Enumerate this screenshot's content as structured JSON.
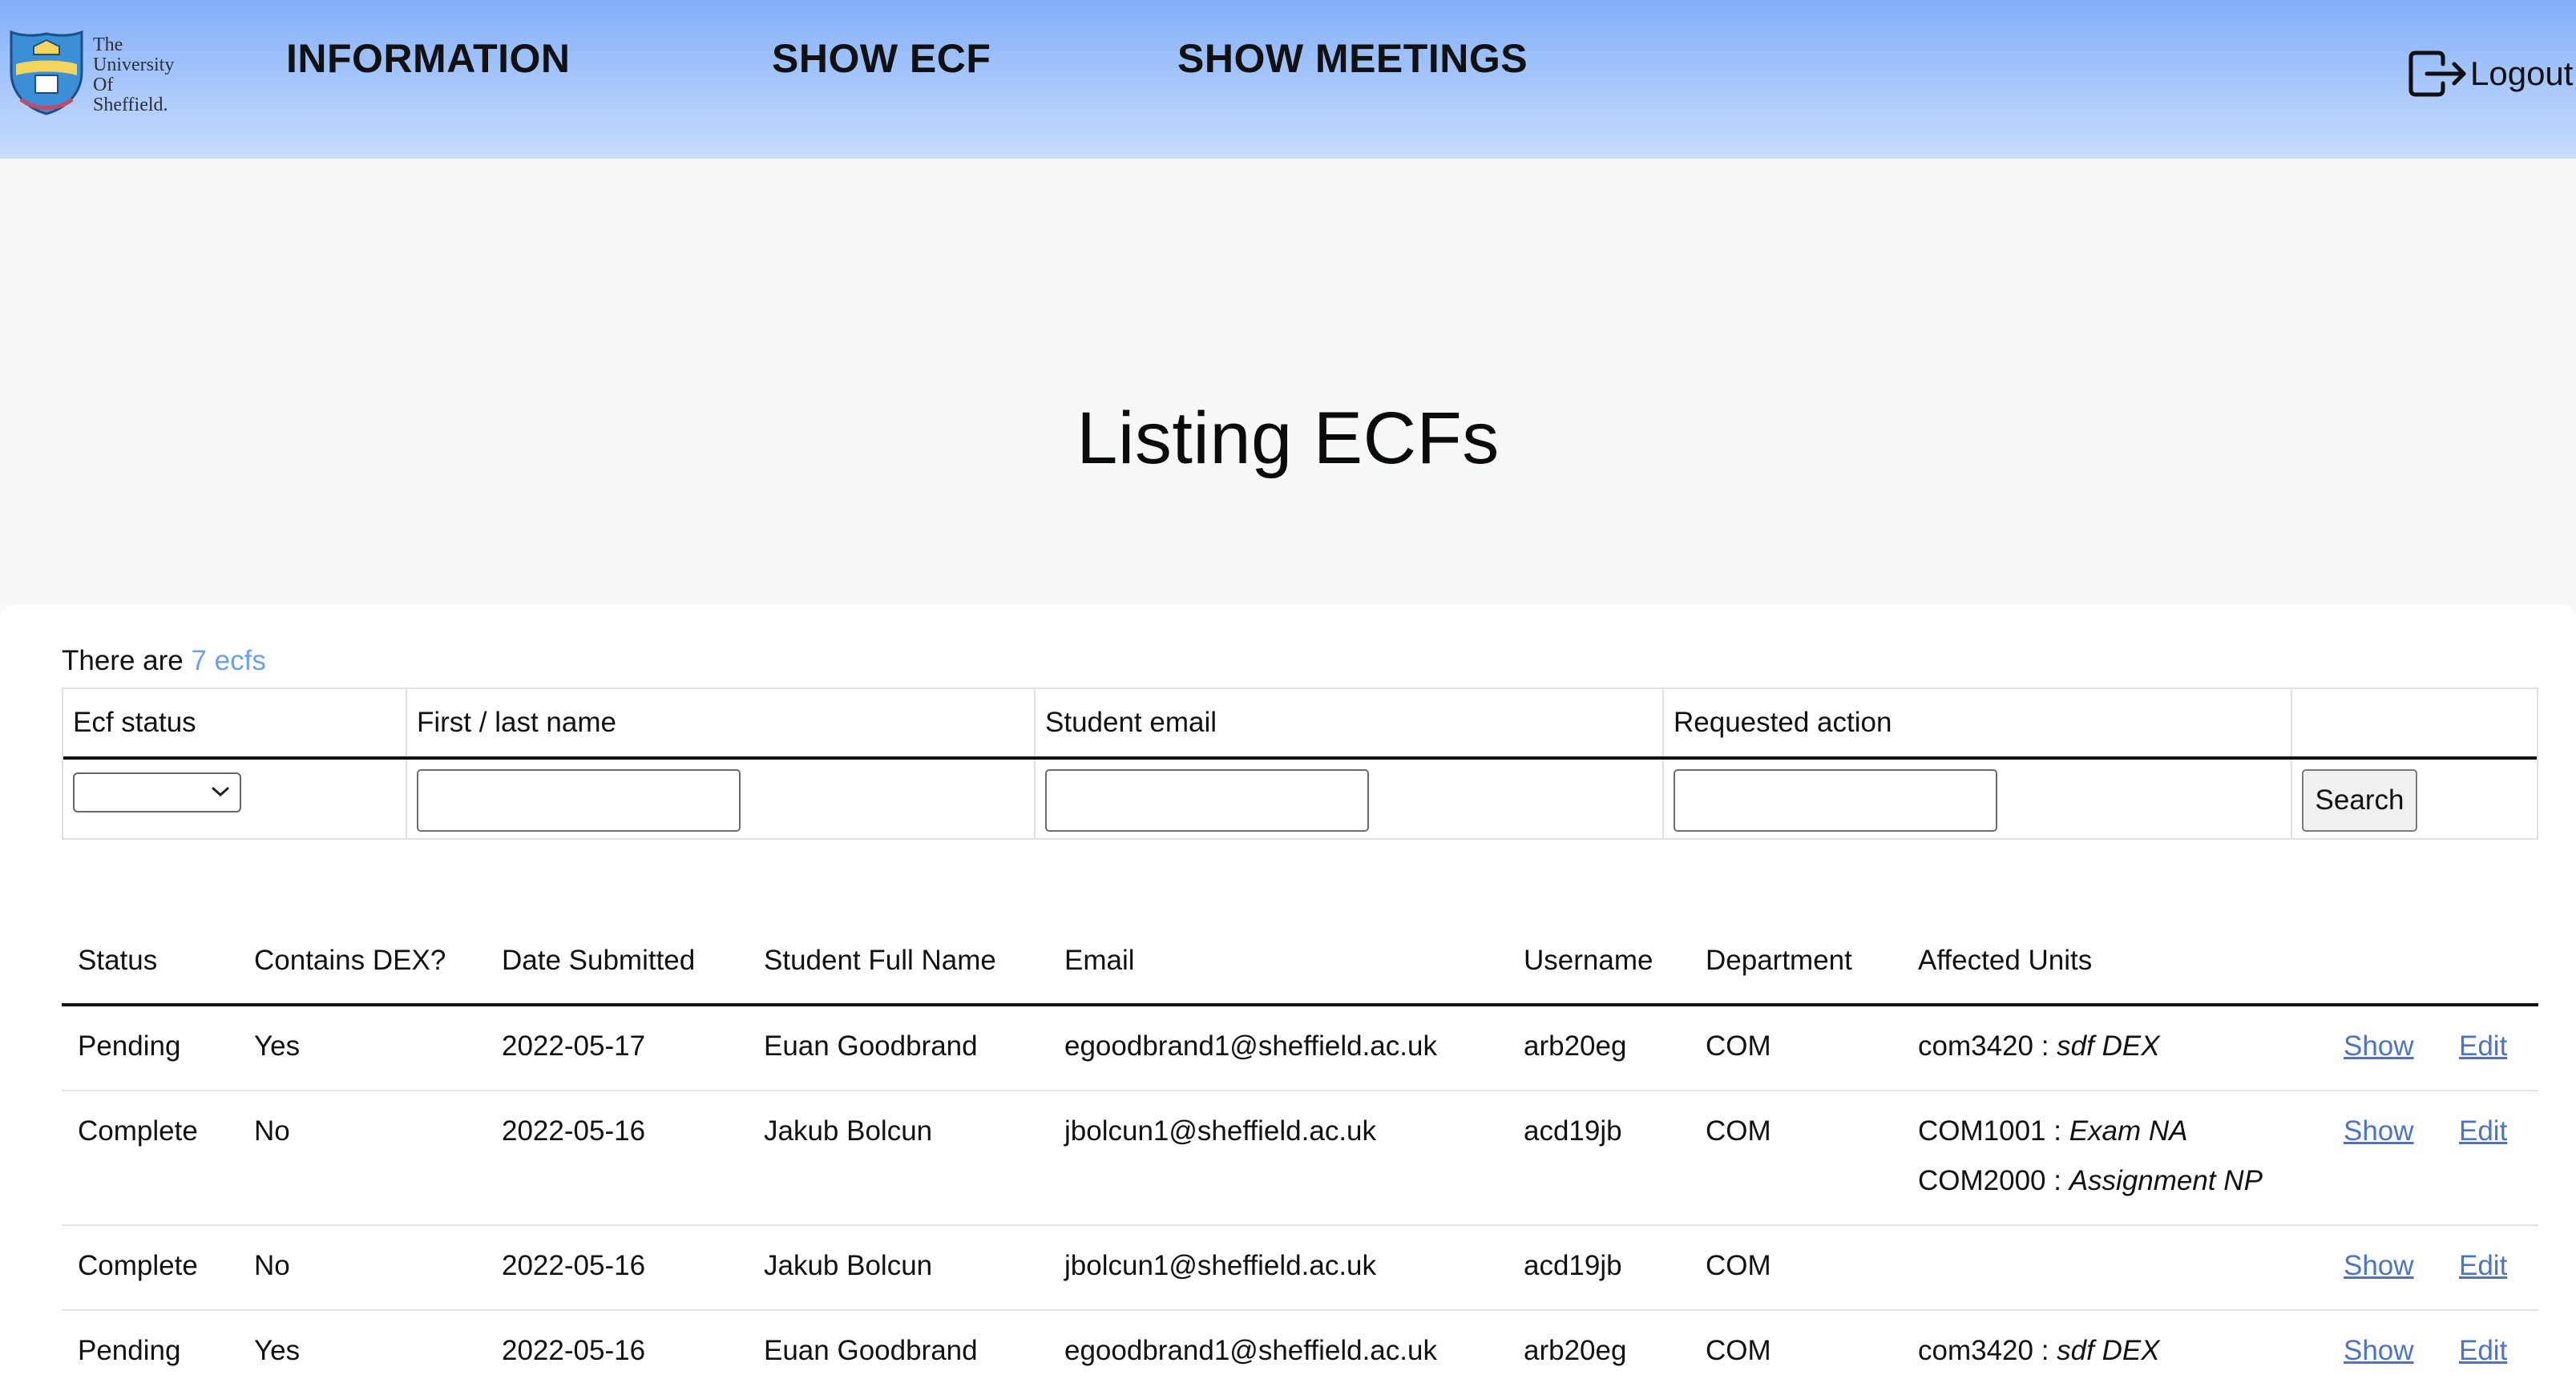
{
  "nav": {
    "logo_lines": [
      "The",
      "University",
      "Of",
      "Sheffield."
    ],
    "items": [
      {
        "label": "INFORMATION"
      },
      {
        "label": "SHOW ECF"
      },
      {
        "label": "SHOW MEETINGS"
      }
    ],
    "logout_label": "Logout"
  },
  "page": {
    "title": "Listing ECFs",
    "count_prefix": "There are",
    "count_link": "7 ecfs"
  },
  "search": {
    "headers": [
      "Ecf status",
      "First / last name",
      "Student email",
      "Requested action",
      ""
    ],
    "status_selected": "",
    "name_value": "",
    "email_value": "",
    "action_value": "",
    "button_label": "Search"
  },
  "table": {
    "headers": [
      "Status",
      "Contains DEX?",
      "Date Submitted",
      "Student Full Name",
      "Email",
      "Username",
      "Department",
      "Affected Units"
    ],
    "show_label": "Show",
    "edit_label": "Edit",
    "rows": [
      {
        "status": "Pending",
        "dex": "Yes",
        "date": "2022-05-17",
        "name": "Euan Goodbrand",
        "email": "egoodbrand1@sheffield.ac.uk",
        "username": "arb20eg",
        "department": "COM",
        "units": [
          {
            "code": "com3420 :",
            "detail": "sdf DEX"
          }
        ]
      },
      {
        "status": "Complete",
        "dex": "No",
        "date": "2022-05-16",
        "name": "Jakub Bolcun",
        "email": "jbolcun1@sheffield.ac.uk",
        "username": "acd19jb",
        "department": "COM",
        "units": [
          {
            "code": "COM1001 :",
            "detail": "Exam NA"
          },
          {
            "code": "COM2000 :",
            "detail": "Assignment NP"
          }
        ]
      },
      {
        "status": "Complete",
        "dex": "No",
        "date": "2022-05-16",
        "name": "Jakub Bolcun",
        "email": "jbolcun1@sheffield.ac.uk",
        "username": "acd19jb",
        "department": "COM",
        "units": []
      },
      {
        "status": "Pending",
        "dex": "Yes",
        "date": "2022-05-16",
        "name": "Euan Goodbrand",
        "email": "egoodbrand1@sheffield.ac.uk",
        "username": "arb20eg",
        "department": "COM",
        "units": [
          {
            "code": "com3420 :",
            "detail": "sdf DEX"
          }
        ]
      }
    ]
  },
  "colors": {
    "nav_gradient_top": "#82aef8",
    "link_blue": "#4a74c9",
    "count_link": "#6aa1ee"
  }
}
